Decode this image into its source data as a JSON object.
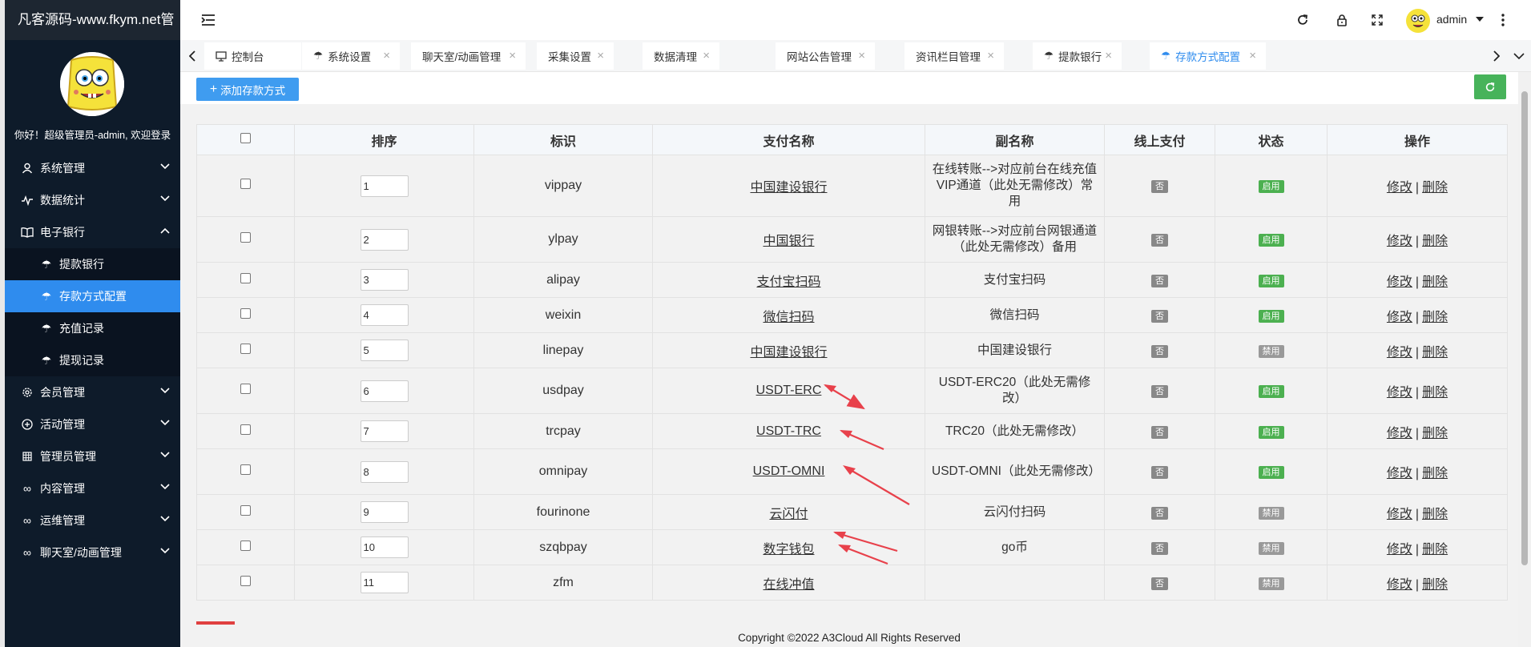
{
  "brand": "凡客源码-www.fkym.net管",
  "welcome": "你好！超级管理员-admin, 欢迎登录",
  "menu": [
    {
      "label": "系统管理",
      "icon": "user-icon"
    },
    {
      "label": "数据统计",
      "icon": "pulse-icon"
    },
    {
      "label": "电子银行",
      "icon": "book-icon",
      "expanded": true
    },
    {
      "label": "会员管理",
      "icon": "gear-icon"
    },
    {
      "label": "活动管理",
      "icon": "plus-circle-icon"
    },
    {
      "label": "管理员管理",
      "icon": "grid-icon"
    },
    {
      "label": "内容管理",
      "icon": "infinity-icon"
    },
    {
      "label": "运维管理",
      "icon": "infinity-icon"
    },
    {
      "label": "聊天室/动画管理",
      "icon": "infinity-icon"
    }
  ],
  "submenu": [
    {
      "label": "提款银行"
    },
    {
      "label": "存款方式配置",
      "active": true
    },
    {
      "label": "充值记录"
    },
    {
      "label": "提现记录"
    }
  ],
  "header": {
    "user": "admin"
  },
  "tabs": [
    {
      "label": "控制台"
    },
    {
      "label": "系统设置"
    },
    {
      "label": "聊天室/动画管理"
    },
    {
      "label": "采集设置"
    },
    {
      "label": "数据清理"
    },
    {
      "label": "网站公告管理"
    },
    {
      "label": "资讯栏目管理"
    },
    {
      "label": "提款银行"
    },
    {
      "label": "存款方式配置"
    }
  ],
  "toolbar": {
    "add_label": "添加存款方式"
  },
  "table": {
    "headers": [
      "排序",
      "标识",
      "支付名称",
      "副名称",
      "线上支付",
      "状态",
      "操作"
    ],
    "rows": [
      {
        "sort": "1",
        "code": "vippay",
        "name": "中国建设银行",
        "sub": "在线转账-->对应前台在线充值VIP通道（此处无需修改）常用",
        "online": "否",
        "status": "启用"
      },
      {
        "sort": "2",
        "code": "ylpay",
        "name": "中国银行",
        "sub": "网银转账-->对应前台网银通道（此处无需修改）备用",
        "online": "否",
        "status": "启用"
      },
      {
        "sort": "3",
        "code": "alipay",
        "name": "支付宝扫码",
        "sub": "支付宝扫码",
        "online": "否",
        "status": "启用"
      },
      {
        "sort": "4",
        "code": "weixin",
        "name": "微信扫码",
        "sub": "微信扫码",
        "online": "否",
        "status": "启用"
      },
      {
        "sort": "5",
        "code": "linepay",
        "name": "中国建设银行",
        "sub": "中国建设银行",
        "online": "否",
        "status": "禁用"
      },
      {
        "sort": "6",
        "code": "usdpay",
        "name": "USDT-ERC",
        "sub": "USDT-ERC20（此处无需修改）",
        "online": "否",
        "status": "启用"
      },
      {
        "sort": "7",
        "code": "trcpay",
        "name": "USDT-TRC",
        "sub": "TRC20（此处无需修改）",
        "online": "否",
        "status": "启用"
      },
      {
        "sort": "8",
        "code": "omnipay",
        "name": "USDT-OMNI",
        "sub": "USDT-OMNI（此处无需修改）",
        "online": "否",
        "status": "启用"
      },
      {
        "sort": "9",
        "code": "fourinone",
        "name": "云闪付",
        "sub": "云闪付扫码",
        "online": "否",
        "status": "禁用"
      },
      {
        "sort": "10",
        "code": "szqbpay",
        "name": "数字钱包",
        "sub": "go币",
        "online": "否",
        "status": "禁用"
      },
      {
        "sort": "11",
        "code": "zfm",
        "name": "在线冲值",
        "sub": "",
        "online": "否",
        "status": "禁用"
      }
    ],
    "edit_label": "修改",
    "delete_label": "删除",
    "separator": "|"
  },
  "footer": "Copyright ©2022 A3Cloud All Rights Reserved",
  "colors": {
    "accent": "#2f8cee",
    "enabled": "#4cb050",
    "disabled": "#999999",
    "annotation": "#e8414b"
  }
}
